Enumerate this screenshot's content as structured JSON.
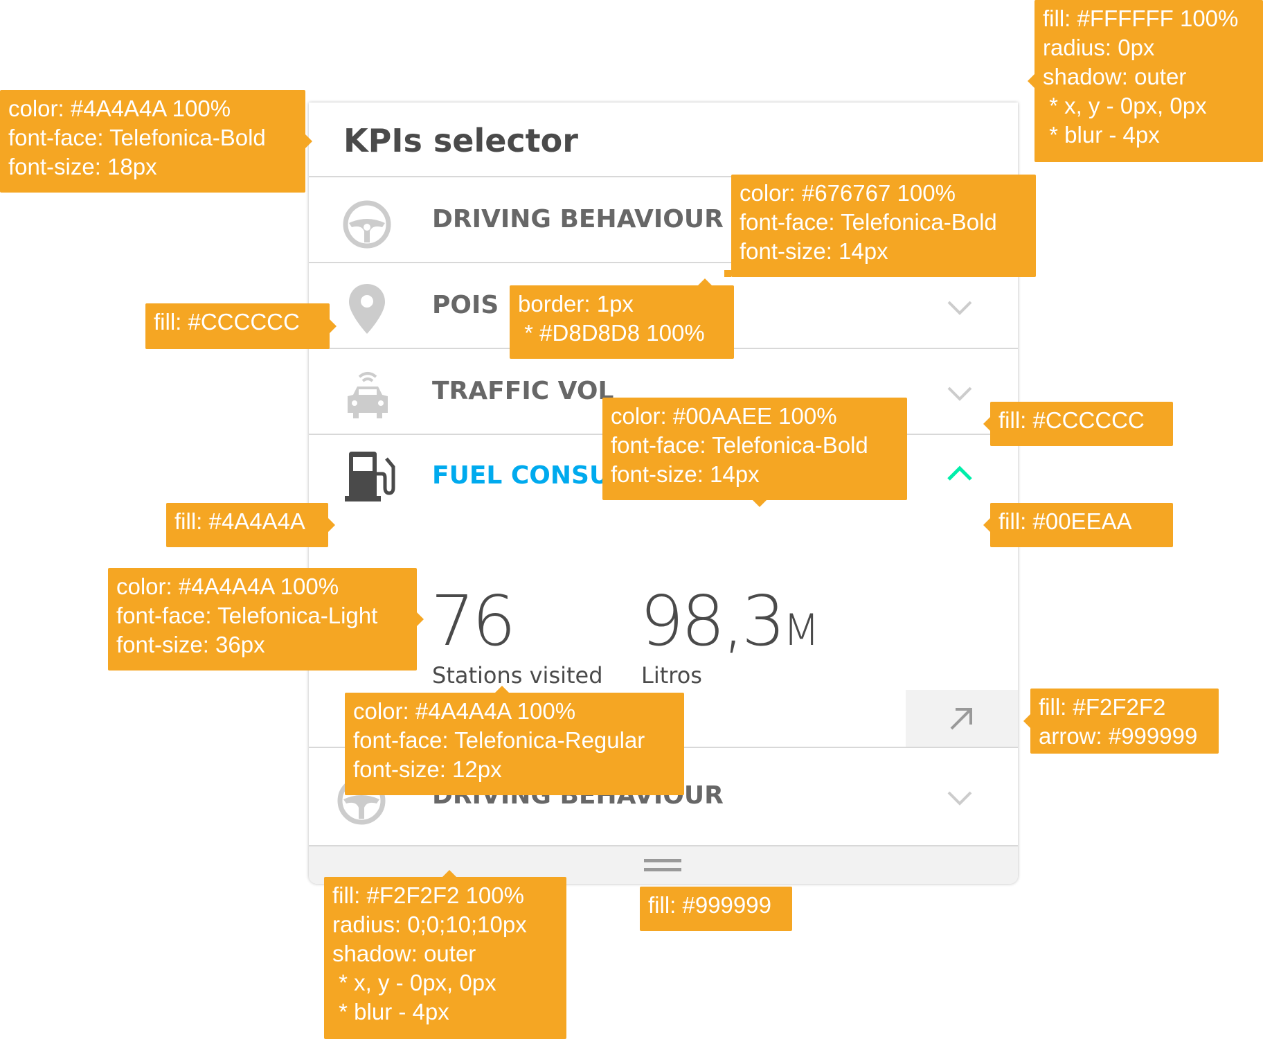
{
  "panel": {
    "title": "KPIs selector",
    "rows": [
      {
        "label": "DRIVING BEHAVIOUR",
        "icon": "steering-wheel-icon"
      },
      {
        "label": "POIS",
        "icon": "map-pin-icon",
        "chevron": "chevron-down-icon"
      },
      {
        "label": "TRAFFIC VOL",
        "icon": "car-wifi-icon",
        "chevron": "chevron-down-icon"
      },
      {
        "label": "FUEL CONSUMPTION",
        "icon": "fuel-pump-icon",
        "chevron": "chevron-up-icon",
        "expanded": true
      },
      {
        "label": "DRIVING BEHAVIOUR",
        "icon": "steering-wheel-icon",
        "chevron": "chevron-down-icon"
      }
    ],
    "fuel_metrics": [
      {
        "value": "76",
        "unit": "",
        "label": "Stations visited"
      },
      {
        "value": "98,3",
        "unit": "M",
        "label": "Litros"
      }
    ],
    "expand_link_icon": "arrow-up-right-icon",
    "footer_icon": "drag-handle-icon"
  },
  "annotations": {
    "title_spec": "color: #4A4A4A 100%\nfont-face: Telefonica-Bold\nfont-size: 18px",
    "panel_spec": "fill: #FFFFFF 100%\nradius: 0px\nshadow: outer\n * x, y - 0px, 0px\n * blur - 4px",
    "row_label_spec": "color: #676767 100%\nfont-face: Telefonica-Bold\nfont-size: 14px",
    "border_spec": "border: 1px\n * #D8D8D8 100%",
    "icon_fill_spec": "fill: #CCCCCC",
    "active_label_spec": "color: #00AAEE 100%\nfont-face: Telefonica-Bold\nfont-size: 14px",
    "chevron_fill_spec": "fill: #CCCCCC",
    "active_icon_spec": "fill: #4A4A4A",
    "active_chevron_spec": "fill: #00EEAA",
    "metric_value_spec": "color: #4A4A4A 100%\nfont-face: Telefonica-Light\nfont-size: 36px",
    "metric_label_spec": "color: #4A4A4A 100%\nfont-face: Telefonica-Regular\nfont-size: 12px",
    "link_box_spec": "fill: #F2F2F2\narrow: #999999",
    "footer_spec": "fill: #F2F2F2 100%\nradius: 0;0;10;10px\nshadow: outer\n * x, y - 0px, 0px\n * blur - 4px",
    "handle_spec": "fill: #999999"
  },
  "colors": {
    "title": "#4A4A4A",
    "row_label": "#676767",
    "active_label": "#00AAEE",
    "icon_inactive": "#CCCCCC",
    "icon_active": "#4A4A4A",
    "chevron_active": "#00EEAA",
    "border": "#D8D8D8",
    "footer": "#F2F2F2",
    "handle": "#999999",
    "annotation": "#F5A623"
  }
}
